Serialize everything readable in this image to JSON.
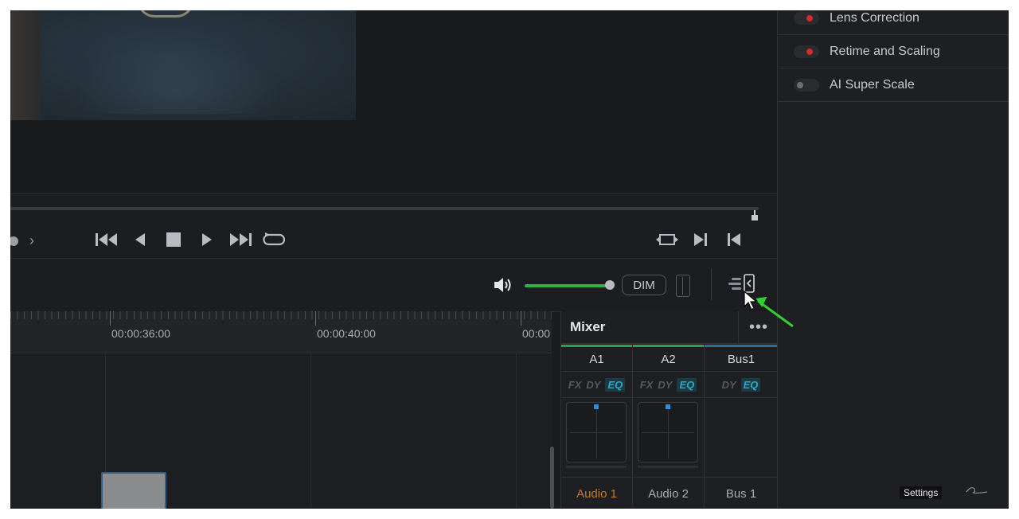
{
  "transport": {
    "buttons": [
      "jump-to-start",
      "prev-frame",
      "stop",
      "play",
      "jump-to-end",
      "loop"
    ],
    "right_buttons": [
      "match-frame",
      "next-edit",
      "prev-edit"
    ]
  },
  "audio": {
    "volume": 0.85,
    "dim_label": "DIM"
  },
  "timeline": {
    "timecodes": [
      "00:00:36:00",
      "00:00:40:00",
      "00:00"
    ]
  },
  "mixer": {
    "title": "Mixer",
    "more": "•••",
    "channels": [
      {
        "name": "A1",
        "fx": [
          "FX",
          "DY",
          "EQ"
        ],
        "label": "Audio 1",
        "bar_color": "#2aa056"
      },
      {
        "name": "A2",
        "fx": [
          "FX",
          "DY",
          "EQ"
        ],
        "label": "Audio 2",
        "bar_color": "#2aa056"
      },
      {
        "name": "Bus1",
        "fx": [
          "DY",
          "EQ"
        ],
        "label": "Bus 1",
        "bar_color": "#2a6f9a"
      }
    ]
  },
  "effects_panel": {
    "items": [
      {
        "label": "Lens Correction",
        "enabled": true
      },
      {
        "label": "Retime and Scaling",
        "enabled": true
      },
      {
        "label": "AI Super Scale",
        "enabled": false
      }
    ]
  },
  "overlay": {
    "settings_label": "Settings"
  },
  "colors": {
    "accent_green": "#2bb34a",
    "led_red": "#d42a2a",
    "eq_cyan": "#2aa8c7"
  }
}
